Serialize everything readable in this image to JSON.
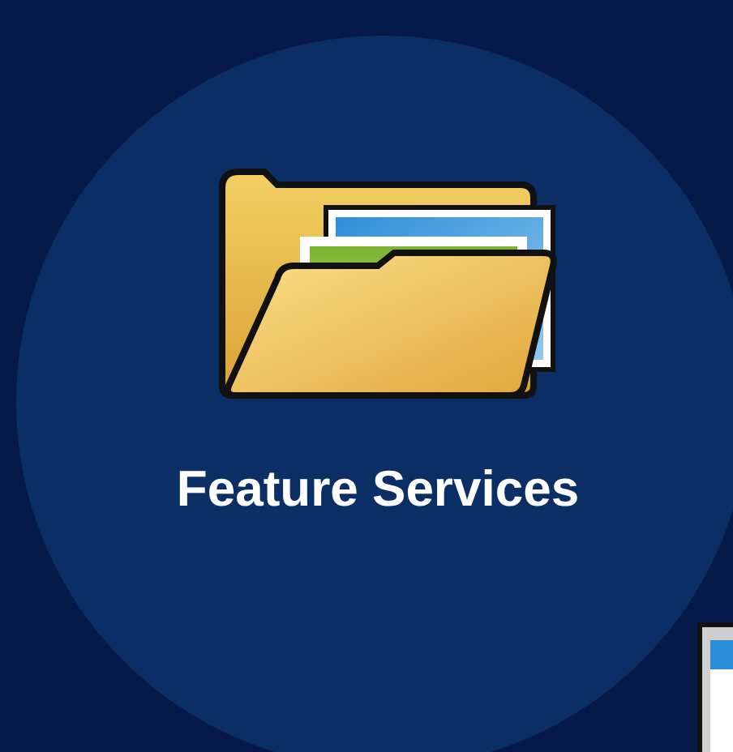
{
  "tile": {
    "label": "Feature Services"
  }
}
